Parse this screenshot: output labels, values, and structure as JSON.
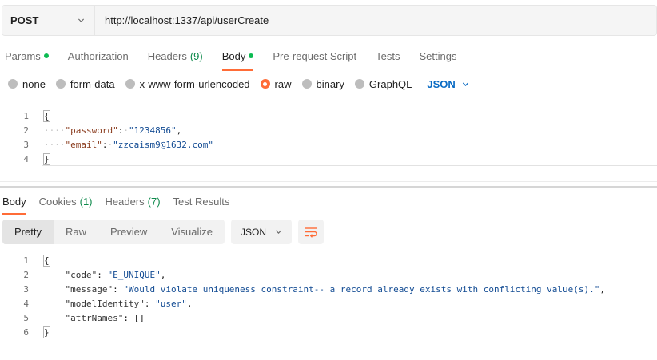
{
  "url_bar": {
    "method": "POST",
    "url": "http://localhost:1337/api/userCreate"
  },
  "request_tabs": [
    {
      "label": "Params",
      "indicator": "green-dot"
    },
    {
      "label": "Authorization"
    },
    {
      "label": "Headers",
      "count": "(9)"
    },
    {
      "label": "Body",
      "indicator": "green-dot",
      "active": true
    },
    {
      "label": "Pre-request Script"
    },
    {
      "label": "Tests"
    },
    {
      "label": "Settings"
    }
  ],
  "body_types": {
    "options": [
      "none",
      "form-data",
      "x-www-form-urlencoded",
      "raw",
      "binary",
      "GraphQL"
    ],
    "selected": "raw",
    "format": "JSON"
  },
  "request_body": {
    "line_numbers": [
      "1",
      "2",
      "3",
      "4"
    ],
    "lines": [
      "{",
      "    \"password\": \"1234856\",",
      "    \"email\": \"zzcaism9@1632.com\"",
      "}"
    ],
    "fields": [
      {
        "key": "\"password\"",
        "value": "\"1234856\"",
        "trail": ","
      },
      {
        "key": "\"email\"",
        "value": "\"zzcaism9@1632.com\"",
        "trail": ""
      }
    ]
  },
  "response_tabs": [
    {
      "label": "Body",
      "active": true
    },
    {
      "label": "Cookies",
      "count": "(1)"
    },
    {
      "label": "Headers",
      "count": "(7)"
    },
    {
      "label": "Test Results"
    }
  ],
  "response_toolbar": {
    "views": [
      "Pretty",
      "Raw",
      "Preview",
      "Visualize"
    ],
    "active_view": "Pretty",
    "format": "JSON"
  },
  "response_body": {
    "line_numbers": [
      "1",
      "2",
      "3",
      "4",
      "5",
      "6"
    ],
    "fields": [
      {
        "key": "\"code\"",
        "value": "\"E_UNIQUE\"",
        "trail": ","
      },
      {
        "key": "\"message\"",
        "value": "\"Would violate uniqueness constraint-- a record already exists with conflicting value(s).\"",
        "trail": ","
      },
      {
        "key": "\"modelIdentity\"",
        "value": "\"user\"",
        "trail": ","
      },
      {
        "key": "\"attrNames\"",
        "value": "[]",
        "trail": ""
      }
    ],
    "open_brace": "{",
    "close_brace": "}"
  },
  "colors": {
    "accent": "#ff6c37",
    "link_blue": "#0a6bc4",
    "green_indicator": "#0cbb52",
    "json_string": "#124b93",
    "json_key_request": "#8a3c1e"
  },
  "icons": {
    "method_dropdown": "chevron-down-icon",
    "format_dropdown": "chevron-down-icon",
    "wrap": "wrap-lines-icon"
  }
}
